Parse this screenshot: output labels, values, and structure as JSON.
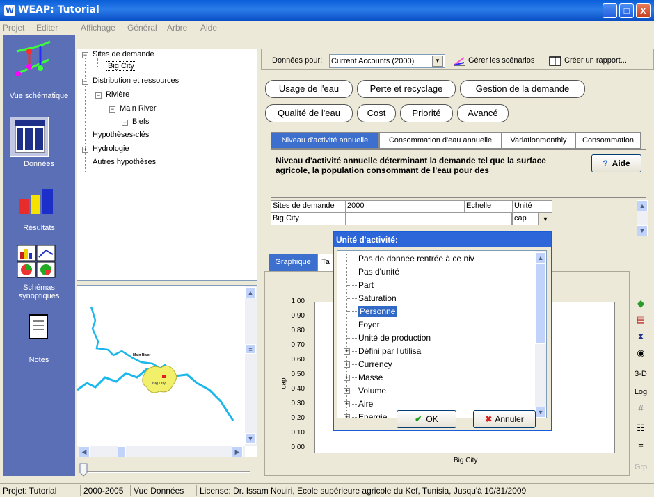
{
  "window": {
    "title": "WEAP: Tutorial",
    "logo": "W",
    "minimize": "_",
    "maximize": "□",
    "close": "X"
  },
  "menu": [
    "Projet",
    "Editer",
    "Affichage",
    "Général",
    "Arbre",
    "Aide"
  ],
  "leftnav": [
    {
      "label": "Vue schématique",
      "icon": "schematic-icon"
    },
    {
      "label": "Données",
      "icon": "data-icon"
    },
    {
      "label": "Résultats",
      "icon": "results-icon"
    },
    {
      "label": "Schémas synoptiques",
      "icon": "overview-icon"
    },
    {
      "label": "Notes",
      "icon": "notes-icon"
    }
  ],
  "tree": {
    "n1": "Sites de demande",
    "n2": "Big City",
    "n3": "Distribution et ressources",
    "n4": "Rivière",
    "n5": "Main River",
    "n6": "Biefs",
    "n7": "Hypothèses-clés",
    "n8": "Hydrologie",
    "n9": "Autres hypothèses"
  },
  "map": {
    "river_label": "Main River",
    "city_label": "Big City"
  },
  "toolbar": {
    "donnees_pour_label": "Données pour:",
    "scenario": "Current Accounts (2000)",
    "manage_scenarios": "Gérer les scénarios",
    "create_report": "Créer un rapport..."
  },
  "pills": [
    "Usage de l'eau",
    "Perte et recyclage",
    "Gestion de la demande",
    "Qualité de l'eau",
    "Cost",
    "Priorité",
    "Avancé"
  ],
  "subtabs": [
    "Niveau d'activité annuelle",
    "Consommation d'eau annuelle",
    "Variationmonthly",
    "Consommation"
  ],
  "description": "Niveau d'activité annuelle déterminant la demande tel que la surface agricole, la population consommant de l'eau pour des",
  "help_button": "Aide",
  "grid": {
    "headers": [
      "Sites de demande",
      "2000",
      "Echelle",
      "Unité"
    ],
    "row": {
      "site": "Big City",
      "value": "",
      "scale": "",
      "unit": "cap"
    }
  },
  "bottomtabs": [
    "Graphique",
    "Ta"
  ],
  "chart_data": {
    "type": "bar",
    "categories": [
      "Big City"
    ],
    "values": [
      0
    ],
    "ylabel": "cap",
    "xlabel": "Big City",
    "yticks": [
      "1.00",
      "0.90",
      "0.80",
      "0.70",
      "0.60",
      "0.50",
      "0.40",
      "0.30",
      "0.20",
      "0.10",
      "0.00"
    ],
    "ylim": [
      0,
      1
    ]
  },
  "sidebar_tools": [
    "3-D",
    "Log",
    "Grp"
  ],
  "dialog": {
    "title": "Unité d'activité:",
    "items": [
      {
        "label": "Pas de donnée rentrée à ce niv",
        "expandable": false
      },
      {
        "label": "Pas d'unité",
        "expandable": false
      },
      {
        "label": "Part",
        "expandable": false
      },
      {
        "label": "Saturation",
        "expandable": false
      },
      {
        "label": "Personne",
        "expandable": false,
        "selected": true
      },
      {
        "label": "Foyer",
        "expandable": false
      },
      {
        "label": "Unité de production",
        "expandable": false
      },
      {
        "label": "Défini par l'utilisa",
        "expandable": true
      },
      {
        "label": "Currency",
        "expandable": true
      },
      {
        "label": "Masse",
        "expandable": true
      },
      {
        "label": "Volume",
        "expandable": true
      },
      {
        "label": "Aire",
        "expandable": true
      },
      {
        "label": "Energie",
        "expandable": true
      }
    ],
    "ok": "OK",
    "cancel": "Annuler"
  },
  "status": {
    "project": "Projet: Tutorial",
    "years": "2000-2005",
    "view": "Vue Données",
    "license": "License: Dr. Issam Nouiri, Ecole supérieure agricole du Kef, Tunisia, Jusqu'à 10/31/2009"
  }
}
